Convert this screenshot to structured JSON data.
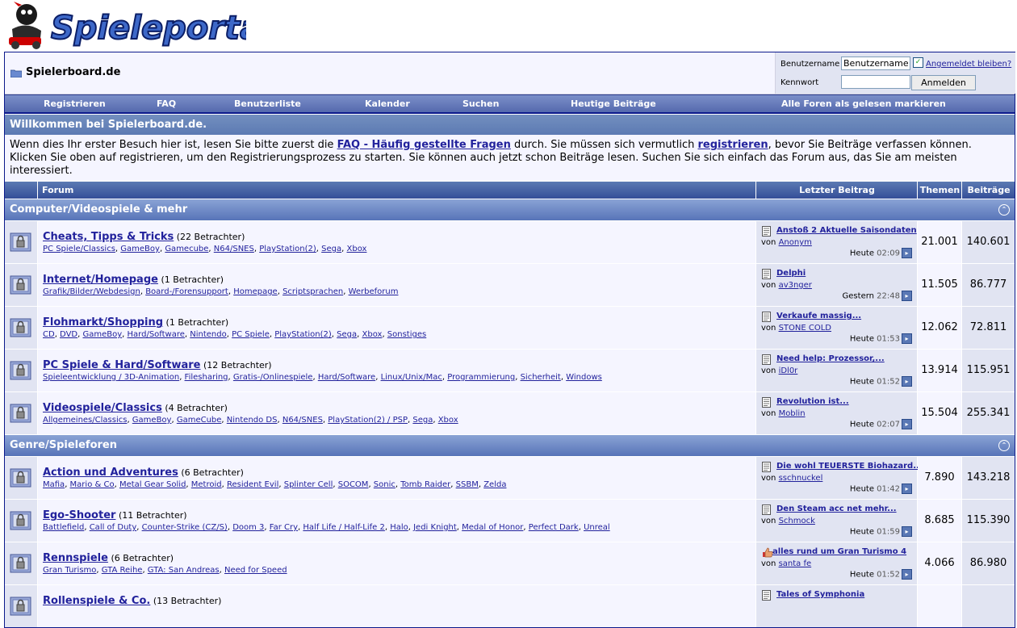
{
  "logo": {
    "text": "Spieleportal.de"
  },
  "breadcrumb": {
    "title": "Spielerboard.de"
  },
  "login": {
    "username_label": "Benutzername",
    "username_value": "Benutzername",
    "password_label": "Kennwort",
    "remember_label": "Angemeldet bleiben?",
    "submit_label": "Anmelden"
  },
  "navbar": {
    "items": [
      "Registrieren",
      "FAQ",
      "Benutzerliste",
      "Kalender",
      "Suchen",
      "Heutige Beiträge",
      "Alle Foren als gelesen markieren"
    ]
  },
  "welcome": {
    "title": "Willkommen bei Spielerboard.de.",
    "text_1": "Wenn dies Ihr erster Besuch hier ist, lesen Sie bitte zuerst die ",
    "faq_link": "FAQ - Häufig gestellte Fragen",
    "text_2": " durch. Sie müssen sich vermutlich ",
    "register_link": "registrieren",
    "text_3": ", bevor Sie Beiträge verfassen können. Klicken Sie oben auf registrieren, um den Registrierungsprozess zu starten. Sie können auch jetzt schon Beiträge lesen. Suchen Sie sich einfach das Forum aus, das Sie am meisten interessiert."
  },
  "columns": {
    "forum": "Forum",
    "last_post": "Letzter Beitrag",
    "themes": "Themen",
    "posts": "Beiträge"
  },
  "categories": [
    {
      "title": "Computer/Videospiele & mehr",
      "forums": [
        {
          "title": "Cheats, Tipps & Tricks",
          "viewers": "(22 Betrachter)",
          "subforums": [
            "PC Spiele/Classics",
            "GameBoy",
            "Gamecube",
            "N64/SNES",
            "PlayStation(2)",
            "Sega",
            "Xbox"
          ],
          "last_title": "Anstoß 2 Aktuelle Saisondaten",
          "last_by_label": "von",
          "last_by": "Anonym",
          "last_day": "Heute",
          "last_time": "02:09",
          "themes": "21.001",
          "posts": "140.601"
        },
        {
          "title": "Internet/Homepage",
          "viewers": "(1 Betrachter)",
          "subforums": [
            "Grafik/Bilder/Webdesign",
            "Board-/Forensupport",
            "Homepage",
            "Scriptsprachen",
            "Werbeforum"
          ],
          "last_title": "Delphi",
          "last_by_label": "von",
          "last_by": "av3nger",
          "last_day": "Gestern",
          "last_time": "22:48",
          "themes": "11.505",
          "posts": "86.777"
        },
        {
          "title": "Flohmarkt/Shopping",
          "viewers": "(1 Betrachter)",
          "subforums": [
            "CD",
            "DVD",
            "GameBoy",
            "Hard/Software",
            "Nintendo",
            "PC Spiele",
            "PlayStation(2)",
            "Sega",
            "Xbox",
            "Sonstiges"
          ],
          "last_title": "Verkaufe massig...",
          "last_by_label": "von",
          "last_by": "STONE COLD",
          "last_day": "Heute",
          "last_time": "01:53",
          "themes": "12.062",
          "posts": "72.811"
        },
        {
          "title": "PC Spiele & Hard/Software",
          "viewers": "(12 Betrachter)",
          "subforums": [
            "Spieleentwicklung / 3D-Animation",
            "Filesharing",
            "Gratis-/Onlinespiele",
            "Hard/Software",
            "Linux/Unix/Mac",
            "Programmierung",
            "Sicherheit",
            "Windows"
          ],
          "last_title": "Need help: Prozessor,...",
          "last_by_label": "von",
          "last_by": "iDl0r",
          "last_day": "Heute",
          "last_time": "01:52",
          "themes": "13.914",
          "posts": "115.951"
        },
        {
          "title": "Videospiele/Classics",
          "viewers": "(4 Betrachter)",
          "subforums": [
            "Allgemeines/Classics",
            "GameBoy",
            "GameCube",
            "Nintendo DS",
            "N64/SNES",
            "PlayStation(2) / PSP",
            "Sega",
            "Xbox"
          ],
          "last_title": "Revolution ist...",
          "last_by_label": "von",
          "last_by": "Moblin",
          "last_day": "Heute",
          "last_time": "02:07",
          "themes": "15.504",
          "posts": "255.341"
        }
      ]
    },
    {
      "title": "Genre/Spieleforen",
      "forums": [
        {
          "title": "Action und Adventures",
          "viewers": "(6 Betrachter)",
          "subforums": [
            "Mafia",
            "Mario & Co",
            "Metal Gear Solid",
            "Metroid",
            "Resident Evil",
            "Splinter Cell",
            "SOCOM",
            "Sonic",
            "Tomb Raider",
            "SSBM",
            "Zelda"
          ],
          "last_title": "Die wohl TEUERSTE Biohazard...",
          "last_by_label": "von",
          "last_by": "sschnuckel",
          "last_day": "Heute",
          "last_time": "01:42",
          "themes": "7.890",
          "posts": "143.218"
        },
        {
          "title": "Ego-Shooter",
          "viewers": "(11 Betrachter)",
          "subforums": [
            "Battlefield",
            "Call of Duty",
            "Counter-Strike (CZ/S)",
            "Doom 3",
            "Far Cry",
            "Half Life / Half-Life 2",
            "Halo",
            "Jedi Knight",
            "Medal of Honor",
            "Perfect Dark",
            "Unreal"
          ],
          "last_title": "Den Steam acc net mehr...",
          "last_by_label": "von",
          "last_by": "Schmock",
          "last_day": "Heute",
          "last_time": "01:59",
          "themes": "8.685",
          "posts": "115.390"
        },
        {
          "title": "Rennspiele",
          "viewers": "(6 Betrachter)",
          "subforums": [
            "Gran Turismo",
            "GTA Reihe",
            "GTA: San Andreas",
            "Need for Speed"
          ],
          "last_title": "alles rund um Gran Turismo 4",
          "last_by_label": "von",
          "last_by": "santa fe",
          "last_day": "Heute",
          "last_time": "01:52",
          "themes": "4.066",
          "posts": "86.980"
        },
        {
          "title": "Rollenspiele & Co.",
          "viewers": "(13 Betrachter)",
          "subforums": [],
          "last_title": "Tales of Symphonia",
          "last_by_label": "",
          "last_by": "",
          "last_day": "",
          "last_time": "",
          "themes": "",
          "posts": ""
        }
      ]
    }
  ],
  "colors": {
    "border": "#0b198c",
    "header": "#5c7ab3",
    "alt1": "#f5f5ff",
    "alt2": "#e1e4f2",
    "link": "#22229c"
  }
}
